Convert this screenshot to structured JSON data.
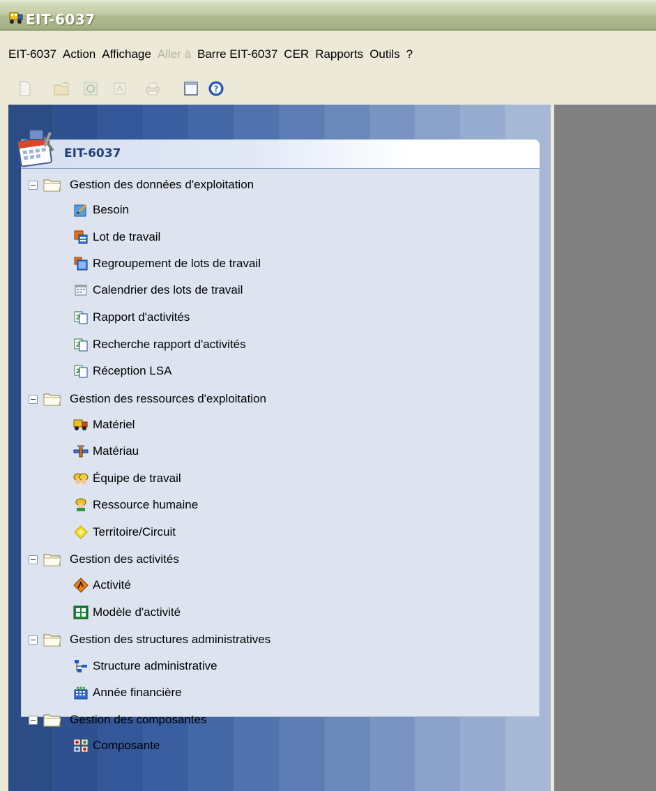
{
  "window": {
    "title": "EIT-6037",
    "app_icon": "truck-icon"
  },
  "menubar": {
    "items": [
      {
        "label": "EIT-6037",
        "enabled": true
      },
      {
        "label": "Action",
        "enabled": true
      },
      {
        "label": "Affichage",
        "enabled": true
      },
      {
        "label": "Aller à",
        "enabled": false
      },
      {
        "label": "Barre EIT-6037",
        "enabled": true
      },
      {
        "label": "CER",
        "enabled": true
      },
      {
        "label": "Rapports",
        "enabled": true
      },
      {
        "label": "Outils",
        "enabled": true
      },
      {
        "label": "?",
        "enabled": true
      }
    ]
  },
  "toolbar": {
    "buttons": [
      "new-document-icon",
      "open-icon",
      "refresh-icon",
      "properties-icon",
      "print-icon",
      "window-icon",
      "help-icon"
    ]
  },
  "panel": {
    "title": "EIT-6037",
    "icon": "calendar-tools-icon"
  },
  "tree": {
    "groups": [
      {
        "label": "Gestion des données d'exploitation",
        "items": [
          {
            "label": "Besoin",
            "icon": "edit-note-icon"
          },
          {
            "label": "Lot de travail",
            "icon": "work-lot-icon"
          },
          {
            "label": "Regroupement de lots de travail",
            "icon": "lot-group-icon"
          },
          {
            "label": "Calendrier des lots de travail",
            "icon": "calendar-icon"
          },
          {
            "label": "Rapport d'activités",
            "icon": "report-icon"
          },
          {
            "label": "Recherche rapport d'activités",
            "icon": "report-search-icon"
          },
          {
            "label": "Réception LSA",
            "icon": "report-receive-icon"
          }
        ]
      },
      {
        "label": "Gestion des ressources d'exploitation",
        "items": [
          {
            "label": "Matériel",
            "icon": "truck-icon"
          },
          {
            "label": "Matériau",
            "icon": "pipe-icon"
          },
          {
            "label": "Équipe de travail",
            "icon": "work-team-icon"
          },
          {
            "label": "Ressource humaine",
            "icon": "worker-icon"
          },
          {
            "label": "Territoire/Circuit",
            "icon": "territory-icon"
          }
        ]
      },
      {
        "label": "Gestion des activités",
        "items": [
          {
            "label": "Activité",
            "icon": "roadwork-sign-icon"
          },
          {
            "label": "Modèle d'activité",
            "icon": "activity-template-icon"
          }
        ]
      },
      {
        "label": "Gestion des structures administratives",
        "items": [
          {
            "label": "Structure administrative",
            "icon": "org-chart-icon"
          },
          {
            "label": "Année financière",
            "icon": "budget-icon"
          }
        ]
      },
      {
        "label": "Gestion des composantes",
        "items": [
          {
            "label": "Composante",
            "icon": "component-icon"
          }
        ]
      }
    ]
  },
  "colors": {
    "titlebar": "#aeb98e",
    "menubar": "#ece9d8",
    "pane_dark": "#2d4f8a",
    "tree_bg": "#dde3ef",
    "header_text": "#1f3f7a",
    "right_pane": "#808080"
  }
}
